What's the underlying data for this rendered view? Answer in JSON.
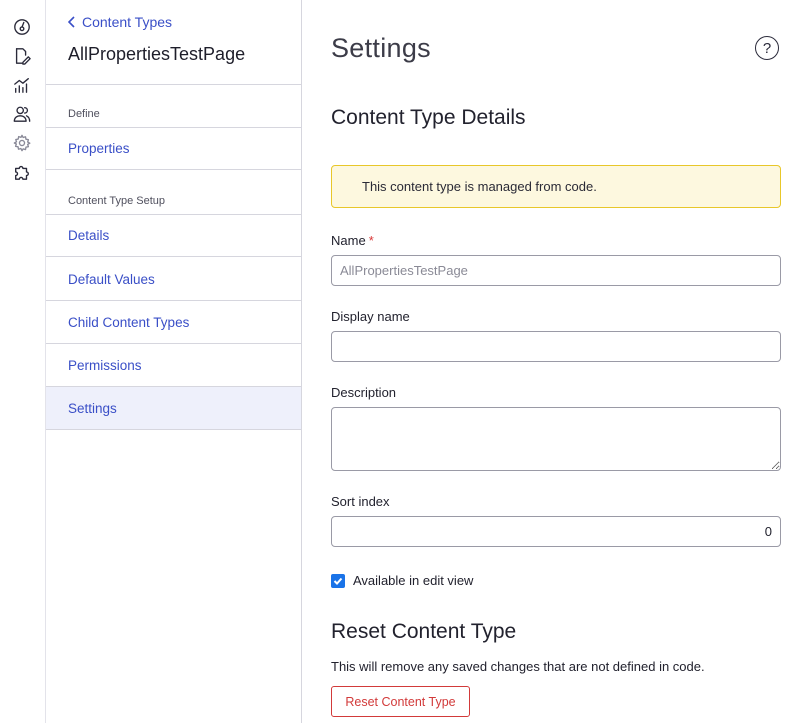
{
  "rail": {
    "icons": [
      "dashboard-icon",
      "edit-content-icon",
      "analytics-icon",
      "users-icon",
      "settings-gear-icon",
      "addons-puzzle-icon"
    ],
    "active": "settings-gear-icon"
  },
  "nav": {
    "back_label": "Content Types",
    "title": "AllPropertiesTestPage",
    "groups": [
      {
        "label": "Define",
        "items": [
          "Properties"
        ]
      },
      {
        "label": "Content Type Setup",
        "items": [
          "Details",
          "Default Values",
          "Child Content Types",
          "Permissions",
          "Settings"
        ]
      }
    ],
    "active_item": "Settings"
  },
  "main": {
    "page_title": "Settings",
    "help_symbol": "?",
    "details_title": "Content Type Details",
    "notice": "This content type is managed from code.",
    "fields": {
      "name_label": "Name",
      "name_required": "*",
      "name_placeholder": "AllPropertiesTestPage",
      "display_name_label": "Display name",
      "display_name_value": "",
      "description_label": "Description",
      "description_value": "",
      "sort_index_label": "Sort index",
      "sort_index_value": "0"
    },
    "available_in_edit_view": {
      "label": "Available in edit view",
      "checked": true
    },
    "reset": {
      "title": "Reset Content Type",
      "description": "This will remove any saved changes that are not defined in code.",
      "button_label": "Reset Content Type"
    }
  },
  "colors": {
    "link": "#3a4fc7",
    "active_nav_bg": "#eef0fb",
    "notice_bg": "#fdf8df",
    "notice_border": "#e8c72a",
    "danger": "#d23a3a",
    "checkbox": "#1a73e8"
  }
}
